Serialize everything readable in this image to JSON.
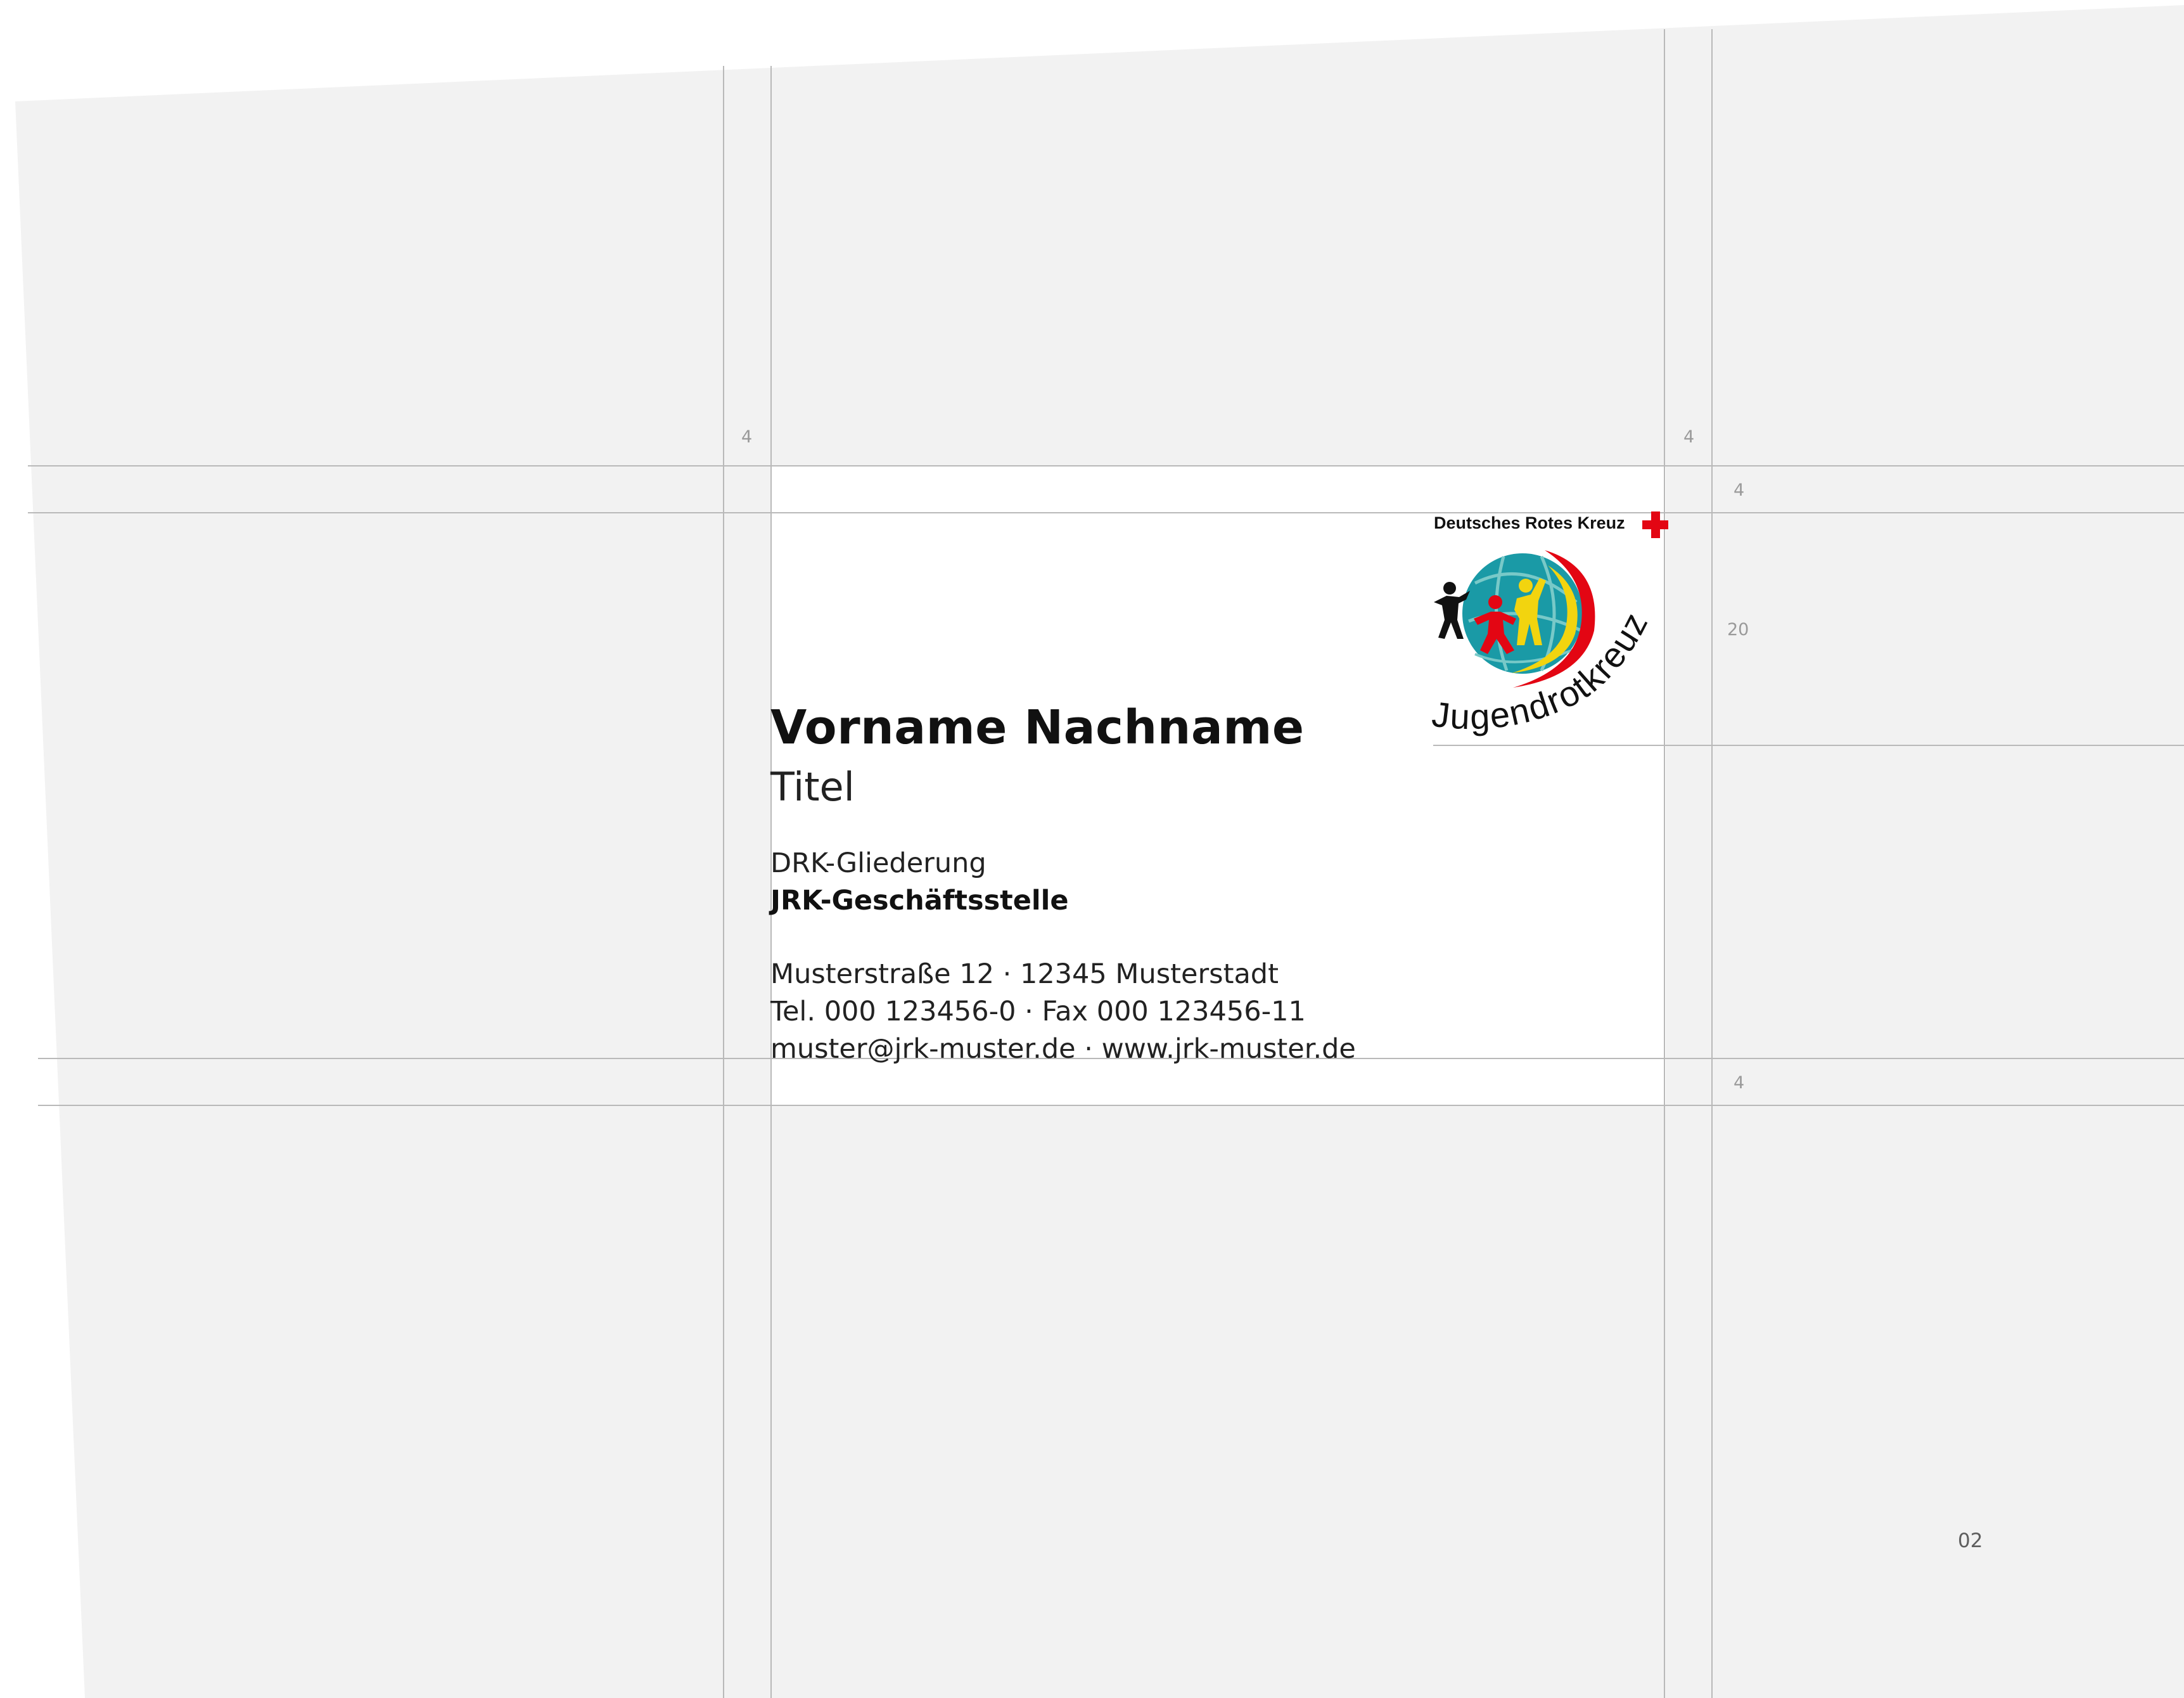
{
  "guides": {
    "dimensions": {
      "left_top": "4",
      "right_top": "4",
      "top_margin": "4",
      "logo_height": "20",
      "bottom_margin": "4"
    },
    "page_number": "02"
  },
  "card": {
    "name": "Vorname Nachname",
    "title": "Titel",
    "organization": "DRK-Gliederung",
    "office": "JRK-Geschäftsstelle",
    "address": "Musterstraße 12 · 12345 Musterstadt",
    "phone": "Tel. 000 123456-0 · Fax 000 123456-11",
    "web": "muster@jrk-muster.de · www.jrk-muster.de"
  },
  "logo": {
    "org_name": "Deutsches Rotes Kreuz",
    "brand_name": "Jugendrotkreuz",
    "colors": {
      "red": "#e30613",
      "teal": "#1a9aa6",
      "yellow": "#f2d40f",
      "black": "#111111"
    }
  },
  "colors": {
    "background": "#f2f2f2",
    "card": "#ffffff",
    "guide": "#b9b9b9"
  }
}
